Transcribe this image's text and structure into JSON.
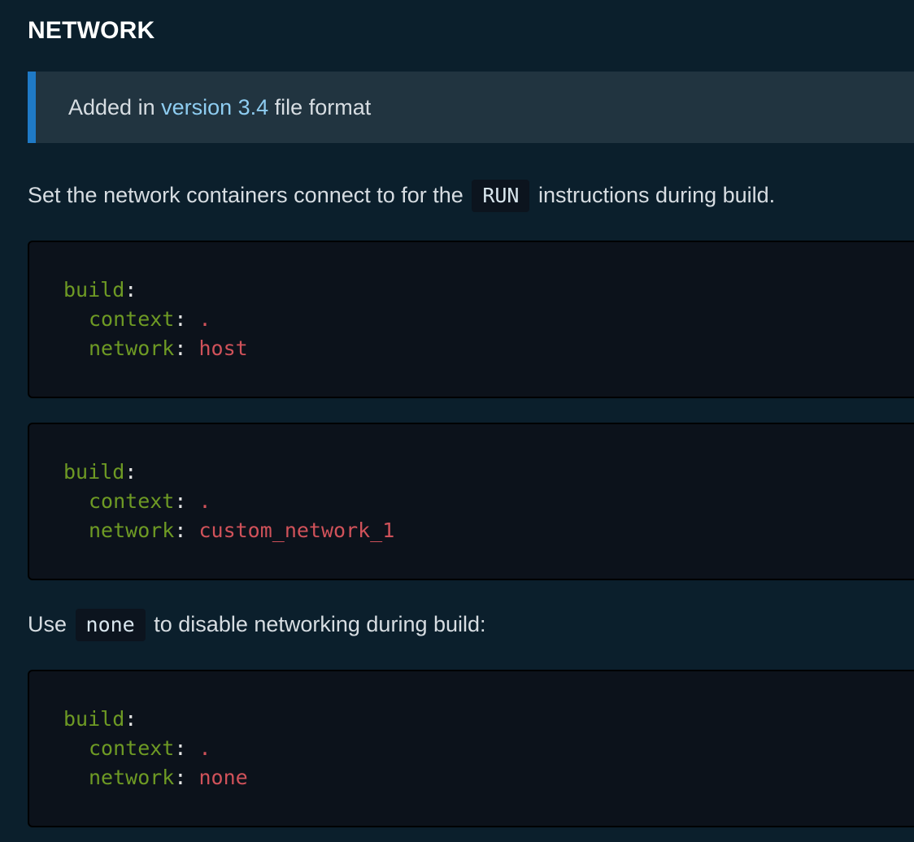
{
  "section": {
    "title": "NETWORK"
  },
  "note": {
    "prefix": "Added in ",
    "link": "version 3.4",
    "suffix": " file format"
  },
  "intro": {
    "before": "Set the network containers connect to for the",
    "code": "RUN",
    "after": "instructions during build."
  },
  "code_blocks": [
    {
      "lines": [
        {
          "key": "build",
          "punct": ":",
          "value": ""
        },
        {
          "key": "context",
          "punct": ": ",
          "value": "."
        },
        {
          "key": "network",
          "punct": ": ",
          "value": "host"
        }
      ]
    },
    {
      "lines": [
        {
          "key": "build",
          "punct": ":",
          "value": ""
        },
        {
          "key": "context",
          "punct": ": ",
          "value": "."
        },
        {
          "key": "network",
          "punct": ": ",
          "value": "custom_network_1"
        }
      ]
    },
    {
      "lines": [
        {
          "key": "build",
          "punct": ":",
          "value": ""
        },
        {
          "key": "context",
          "punct": ": ",
          "value": "."
        },
        {
          "key": "network",
          "punct": ": ",
          "value": "none"
        }
      ]
    }
  ],
  "none_para": {
    "before": "Use",
    "code": "none",
    "after": "to disable networking during build:"
  },
  "colors": {
    "background": "#0b1f2c",
    "note_background": "#213440",
    "note_accent": "#1f7ac6",
    "link": "#8ecdf1",
    "code_background": "#0c121b",
    "yaml_key": "#6e9a24",
    "yaml_value": "#d0525a"
  }
}
